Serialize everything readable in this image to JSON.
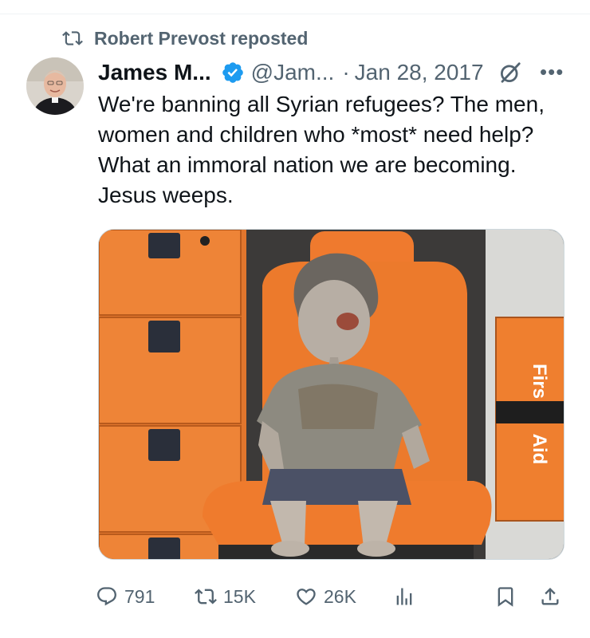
{
  "repost_line": {
    "text": "Robert Prevost reposted",
    "icon": "repost-icon"
  },
  "tweet": {
    "author_name": "James M...",
    "verified": true,
    "handle": "@Jam...",
    "date_sep": "·",
    "date": "Jan 28, 2017",
    "text": "We're banning all Syrian refugees? The men,\nwomen and children who *most* need help?\nWhat an immoral nation we are becoming.\nJesus weeps.",
    "media": {
      "kind": "photo",
      "visible_text": "First Aid"
    }
  },
  "actions": {
    "replies": "791",
    "reposts": "15K",
    "likes": "26K"
  },
  "colors": {
    "text": "#0f1419",
    "muted": "#536471",
    "verified": "#1d9bf0",
    "border": "#cfd9de"
  }
}
